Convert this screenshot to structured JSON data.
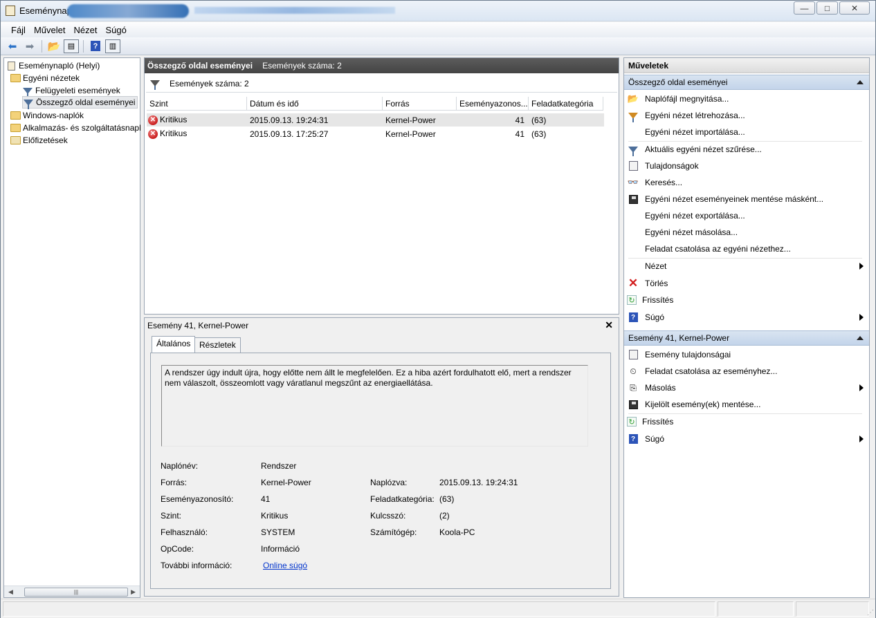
{
  "window": {
    "title": "Eseménynapló"
  },
  "menu": [
    "Fájl",
    "Művelet",
    "Nézet",
    "Súgó"
  ],
  "tree": {
    "root": "Eseménynapló (Helyi)",
    "custom_views": "Egyéni nézetek",
    "admin_events": "Felügyeleti események",
    "summary_events": "Összegző oldal eseményei",
    "windows_logs": "Windows-naplók",
    "app_logs": "Alkalmazás- és szolgáltatásnapl",
    "subscriptions": "Előfizetések"
  },
  "center": {
    "header_title": "Összegző oldal eseményei",
    "header_count": "Események száma: 2",
    "filter_text": "Események száma: 2",
    "columns": [
      "Szint",
      "Dátum és idő",
      "Forrás",
      "Eseményazonos...",
      "Feladatkategória"
    ],
    "rows": [
      {
        "level": "Kritikus",
        "datetime": "2015.09.13. 19:24:31",
        "source": "Kernel-Power",
        "id": "41",
        "category": "(63)"
      },
      {
        "level": "Kritikus",
        "datetime": "2015.09.13. 17:25:27",
        "source": "Kernel-Power",
        "id": "41",
        "category": "(63)"
      }
    ]
  },
  "detail": {
    "title": "Esemény 41, Kernel-Power",
    "close": "✕",
    "tab_general": "Általános",
    "tab_details": "Részletek",
    "description": "A rendszer úgy indult újra, hogy előtte nem állt le megfelelően. Ez a hiba azért fordulhatott elő, mert a rendszer nem válaszolt, összeomlott vagy váratlanul megszűnt az energiaellátása.",
    "labels": {
      "log_name": "Naplónév:",
      "source": "Forrás:",
      "event_id": "Eseményazonosító:",
      "level": "Szint:",
      "user": "Felhasználó:",
      "opcode": "OpCode:",
      "more_info": "További információ:",
      "logged": "Naplózva:",
      "task_category": "Feladatkategória:",
      "keywords": "Kulcsszó:",
      "computer": "Számítógép:"
    },
    "values": {
      "log_name": "Rendszer",
      "source": "Kernel-Power",
      "event_id": "41",
      "level": "Kritikus",
      "user": "SYSTEM",
      "opcode": "Információ",
      "more_info": "Online súgó",
      "logged": "2015.09.13. 19:24:31",
      "task_category": "(63)",
      "keywords": "(2)",
      "computer": "Koola-PC"
    }
  },
  "actions": {
    "title": "Műveletek",
    "section1": "Összegző oldal eseményei",
    "items1": [
      "Naplófájl megnyitása...",
      "Egyéni nézet létrehozása...",
      "Egyéni nézet importálása...",
      "Aktuális egyéni nézet szűrése...",
      "Tulajdonságok",
      "Keresés...",
      "Egyéni nézet eseményeinek mentése másként...",
      "Egyéni nézet exportálása...",
      "Egyéni nézet másolása...",
      "Feladat csatolása az egyéni nézethez...",
      "Nézet",
      "Törlés",
      "Frissítés",
      "Súgó"
    ],
    "section2": "Esemény 41, Kernel-Power",
    "items2": [
      "Esemény tulajdonságai",
      "Feladat csatolása az eseményhez...",
      "Másolás",
      "Kijelölt esemény(ek) mentése...",
      "Frissítés",
      "Súgó"
    ]
  }
}
